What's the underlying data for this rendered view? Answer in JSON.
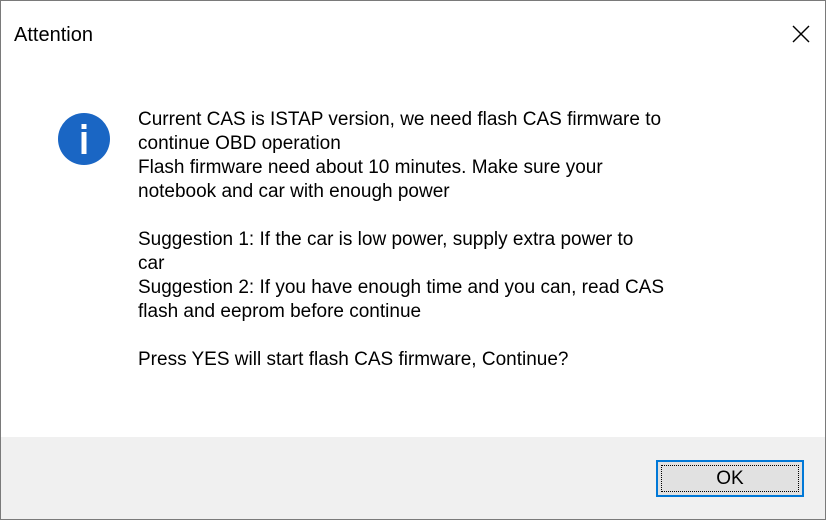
{
  "window": {
    "title": "Attention"
  },
  "icon": {
    "name": "information-icon",
    "glyph": "i",
    "color": "#1a66c4"
  },
  "message": {
    "lines": [
      "Current CAS is ISTAP version, we need flash CAS firmware to",
      "continue OBD operation",
      "Flash firmware need about 10 minutes. Make sure your",
      "notebook and car with enough power",
      "",
      "Suggestion 1: If the car is low power, supply extra power to",
      "car",
      "Suggestion 2: If you have enough time and you can, read CAS",
      "flash and eeprom before continue",
      "",
      "Press YES will start flash CAS firmware, Continue?"
    ]
  },
  "buttons": {
    "ok_label": "OK"
  },
  "colors": {
    "accent": "#0078d7",
    "footer_bg": "#f0f0f0",
    "button_bg": "#e1e1e1"
  }
}
